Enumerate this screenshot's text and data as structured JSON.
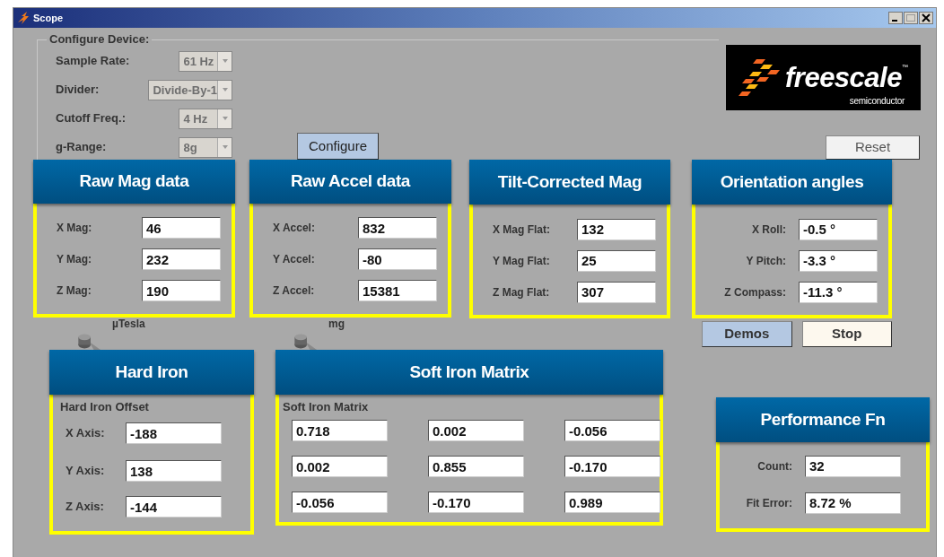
{
  "window": {
    "title": "Scope"
  },
  "configure_device": {
    "legend": "Configure Device:",
    "fields": [
      {
        "label": "Sample Rate:",
        "value": "61 Hz",
        "disabled": true
      },
      {
        "label": "Divider:",
        "value": "Divide-By-1",
        "disabled": true
      },
      {
        "label": "Cutoff Freq.:",
        "value": "4 Hz",
        "disabled": true
      },
      {
        "label": "g-Range:",
        "value": "8g",
        "disabled": true
      }
    ],
    "configure_button": "Configure"
  },
  "logo": {
    "name": "freescale",
    "trademark": "™",
    "tagline": "semiconductor"
  },
  "reset_button": "Reset",
  "panels": [
    {
      "title": "Raw Mag data",
      "unit": "µTesla",
      "fields": [
        {
          "label": "X Mag:",
          "value": "46"
        },
        {
          "label": "Y Mag:",
          "value": "232"
        },
        {
          "label": "Z Mag:",
          "value": "190"
        }
      ]
    },
    {
      "title": "Raw Accel data",
      "unit": "mg",
      "fields": [
        {
          "label": "X Accel:",
          "value": "832"
        },
        {
          "label": "Y Accel:",
          "value": "-80"
        },
        {
          "label": "Z Accel:",
          "value": "15381"
        }
      ]
    },
    {
      "title": "Tilt-Corrected Mag",
      "fields": [
        {
          "label": "X Mag Flat:",
          "value": "132"
        },
        {
          "label": "Y Mag Flat:",
          "value": "25"
        },
        {
          "label": "Z Mag Flat:",
          "value": "307"
        }
      ]
    },
    {
      "title": "Orientation angles",
      "fields": [
        {
          "label": "X Roll:",
          "value": "-0.5 °"
        },
        {
          "label": "Y Pitch:",
          "value": "-3.3 °"
        },
        {
          "label": "Z Compass:",
          "value": "-11.3 °"
        }
      ]
    }
  ],
  "demos_button": "Demos",
  "stop_button": "Stop",
  "hard_iron": {
    "title": "Hard Iron",
    "caption": "Hard Iron Offset",
    "fields": [
      {
        "label": "X Axis:",
        "value": "-188"
      },
      {
        "label": "Y Axis:",
        "value": "138"
      },
      {
        "label": "Z Axis:",
        "value": "-144"
      }
    ]
  },
  "soft_iron": {
    "title": "Soft Iron Matrix",
    "caption": "Soft Iron Matrix",
    "matrix": [
      [
        "0.718",
        "0.002",
        "-0.056"
      ],
      [
        "0.002",
        "0.855",
        "-0.170"
      ],
      [
        "-0.056",
        "-0.170",
        "0.989"
      ]
    ]
  },
  "performance": {
    "title": "Performance Fn",
    "fields": [
      {
        "label": "Count:",
        "value": "32"
      },
      {
        "label": "Fit Error:",
        "value": "8.72 %"
      }
    ]
  }
}
